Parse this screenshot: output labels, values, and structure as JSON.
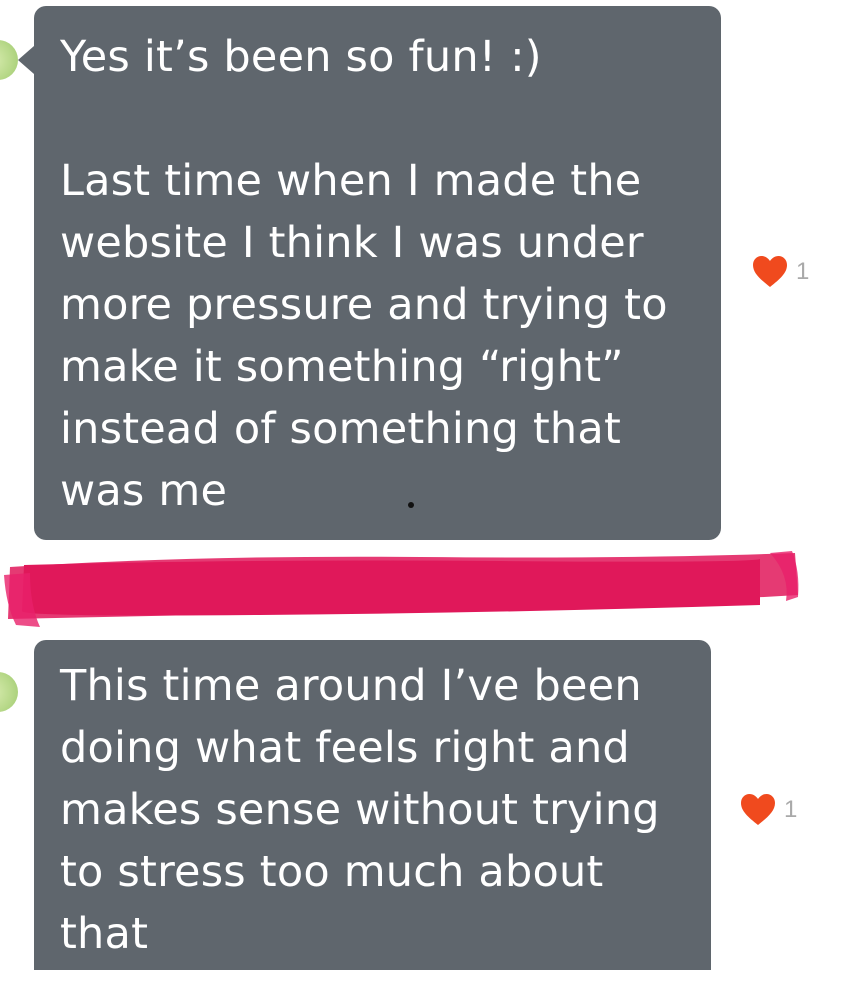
{
  "messages": [
    {
      "paragraph_1": "Yes it’s been so fun! :)",
      "paragraph_2": "Last time when I made the\nwebsite I think I was under\nmore pressure and trying to\nmake it something “right”\ninstead of something that\nwas me",
      "reaction": {
        "icon": "heart-icon",
        "count": "1",
        "color": "#f04a1e"
      }
    },
    {
      "text": "This time around I’ve been\ndoing what feels right and\nmakes sense without trying\nto stress too much about\nthat",
      "reaction": {
        "icon": "heart-icon",
        "count": "1",
        "color": "#f04a1e"
      }
    }
  ],
  "colors": {
    "bubble": "#5f666d",
    "redaction": "#e0185a",
    "avatar": "#b8d98a"
  }
}
